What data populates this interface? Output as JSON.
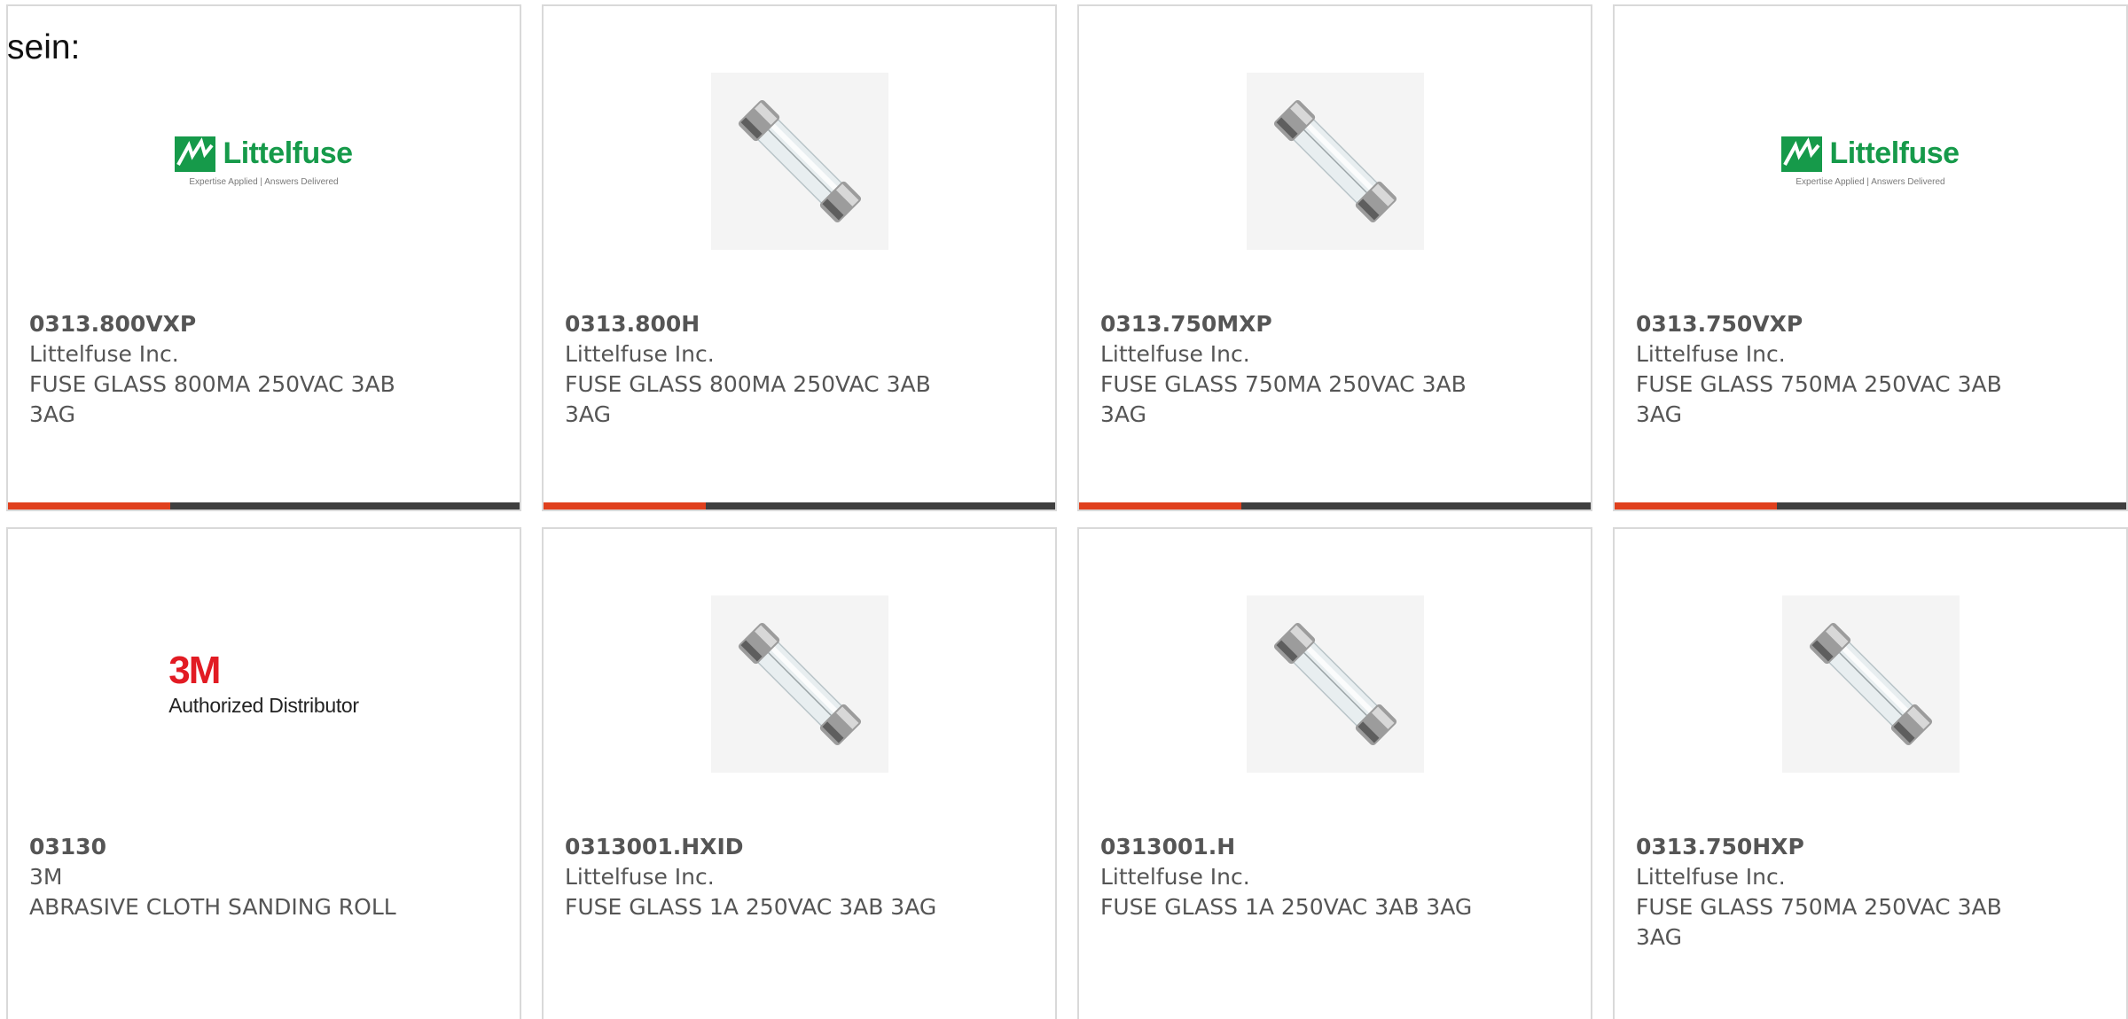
{
  "intro_text": "sein:",
  "products": [
    {
      "part": "0313.800VXP",
      "maker": "Littelfuse Inc.",
      "desc": "FUSE GLASS 800MA 250VAC 3AB 3AG",
      "image": "littelfuse-logo",
      "accent_bar": true
    },
    {
      "part": "0313.800H",
      "maker": "Littelfuse Inc.",
      "desc": "FUSE GLASS 800MA 250VAC 3AB 3AG",
      "image": "glass-fuse",
      "accent_bar": true
    },
    {
      "part": "0313.750MXP",
      "maker": "Littelfuse Inc.",
      "desc": "FUSE GLASS 750MA 250VAC 3AB 3AG",
      "image": "glass-fuse",
      "accent_bar": true
    },
    {
      "part": "0313.750VXP",
      "maker": "Littelfuse Inc.",
      "desc": "FUSE GLASS 750MA 250VAC 3AB 3AG",
      "image": "littelfuse-logo",
      "accent_bar": true
    },
    {
      "part": "03130",
      "maker": "3M",
      "desc": "ABRASIVE CLOTH SANDING ROLL",
      "image": "3m-logo",
      "accent_bar": false
    },
    {
      "part": "0313001.HXID",
      "maker": "Littelfuse Inc.",
      "desc": "FUSE GLASS 1A 250VAC 3AB 3AG",
      "image": "glass-fuse",
      "accent_bar": false
    },
    {
      "part": "0313001.H",
      "maker": "Littelfuse Inc.",
      "desc": "FUSE GLASS 1A 250VAC 3AB 3AG",
      "image": "glass-fuse",
      "accent_bar": false
    },
    {
      "part": "0313.750HXP",
      "maker": "Littelfuse Inc.",
      "desc": "FUSE GLASS 750MA 250VAC 3AB 3AG",
      "image": "glass-fuse",
      "accent_bar": false
    }
  ],
  "logos": {
    "littelfuse": {
      "word": "Littelfuse",
      "tagline": "Expertise Applied | Answers Delivered"
    },
    "three_m": {
      "mark": "3M",
      "subtitle": "Authorized Distributor"
    }
  },
  "colors": {
    "accent": "#e0401d",
    "bar": "#3f3f3f",
    "littelfuse_green": "#169a4a",
    "three_m_red": "#e21b23",
    "text": "#555555"
  }
}
